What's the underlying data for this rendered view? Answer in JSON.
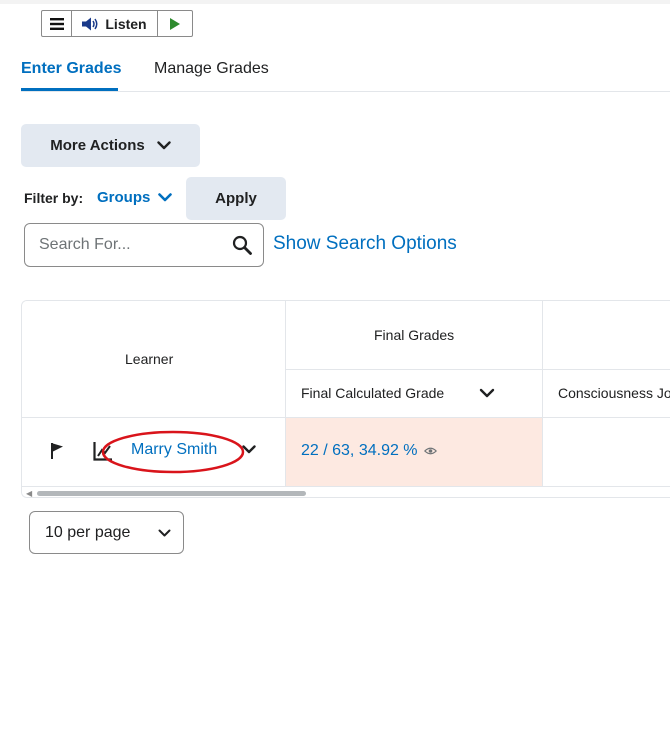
{
  "toolbar": {
    "listen_label": "Listen"
  },
  "tabs": [
    {
      "label": "Enter Grades",
      "active": true
    },
    {
      "label": "Manage Grades",
      "active": false
    }
  ],
  "actions": {
    "more_actions_label": "More Actions"
  },
  "filter": {
    "label": "Filter by:",
    "groups_label": "Groups",
    "apply_label": "Apply"
  },
  "search": {
    "placeholder": "Search For...",
    "show_options_label": "Show Search Options"
  },
  "table": {
    "learner_header": "Learner",
    "group_header": "Final Grades",
    "columns": [
      "Final Calculated Grade",
      "Consciousness Jo"
    ],
    "rows": [
      {
        "learner": "Marry Smith",
        "final_grade": "22 / 63, 34.92 %"
      }
    ]
  },
  "pagination": {
    "per_page_label": "10 per page"
  },
  "colors": {
    "accent": "#006fbf",
    "grade_cell_bg": "#fde9e1",
    "annotation": "#d9141b"
  }
}
